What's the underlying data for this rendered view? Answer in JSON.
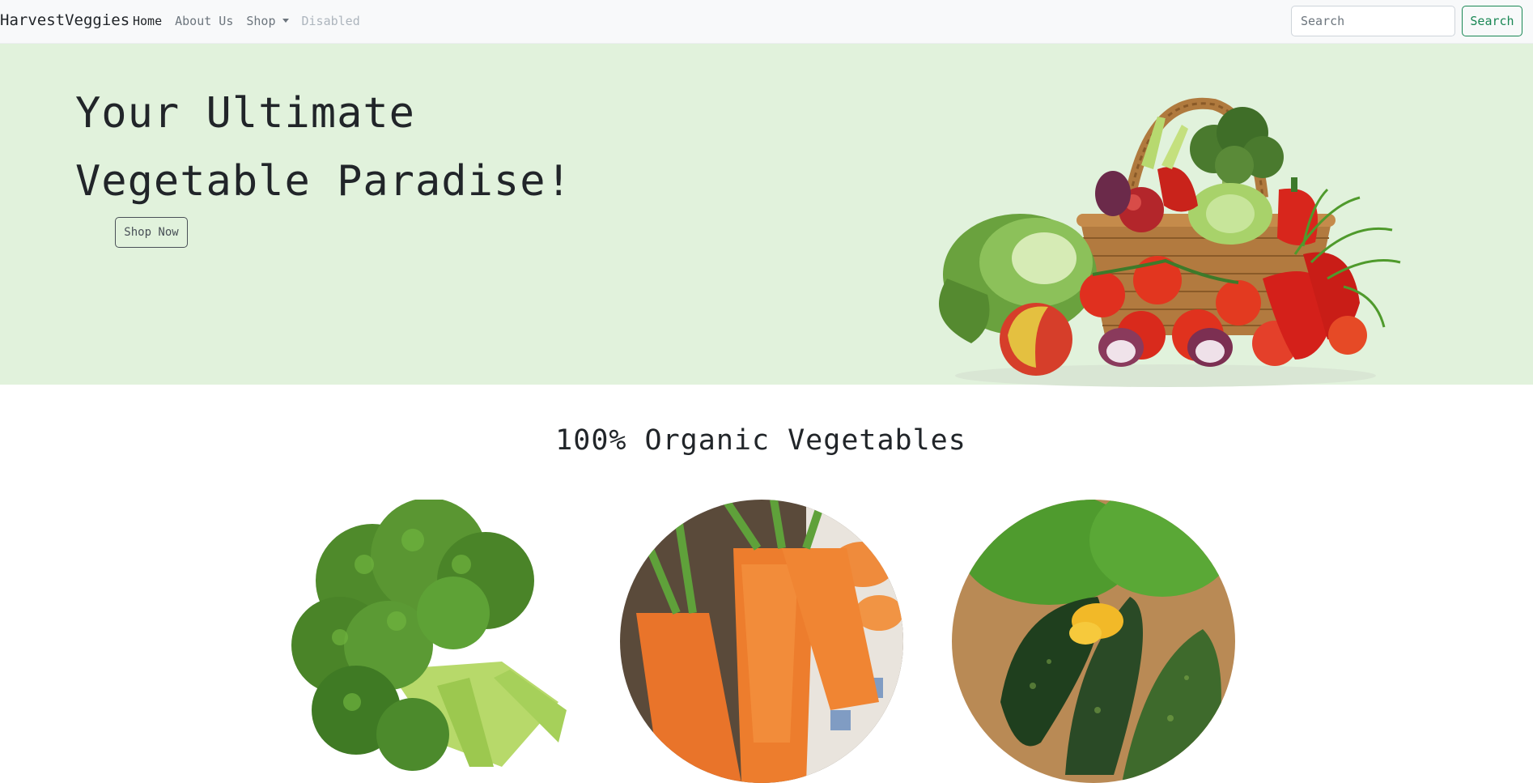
{
  "navbar": {
    "brand": "HarvestVeggies",
    "links": [
      {
        "label": "Home"
      },
      {
        "label": "About Us"
      },
      {
        "label": "Shop"
      },
      {
        "label": "Disabled"
      }
    ],
    "search": {
      "placeholder": "Search",
      "value": "",
      "button": "Search"
    },
    "colors": {
      "bg": "#f8f9fa",
      "accent": "#198754"
    }
  },
  "hero": {
    "title": "Your Ultimate Vegetable Paradise!",
    "button": "Shop Now",
    "image": "vegetable-basket-image",
    "bg": "#e1f2dc"
  },
  "section": {
    "title": "100% Organic Vegetables",
    "items": [
      {
        "image": "broccoli-image"
      },
      {
        "image": "carrots-image"
      },
      {
        "image": "zucchini-image"
      }
    ]
  }
}
